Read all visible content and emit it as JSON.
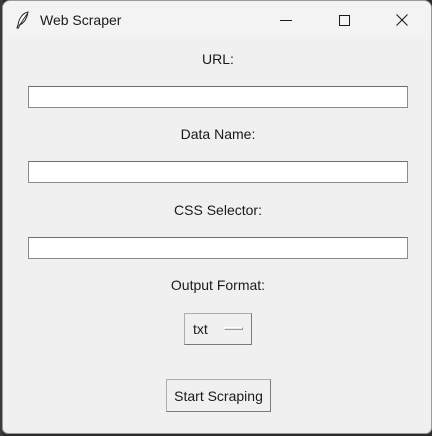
{
  "window": {
    "title": "Web Scraper",
    "icons": {
      "app": "feather-icon",
      "minimize": "minimize-icon",
      "maximize": "maximize-icon",
      "close": "close-icon"
    }
  },
  "form": {
    "url_label": "URL:",
    "url_value": "",
    "data_name_label": "Data Name:",
    "data_name_value": "",
    "css_selector_label": "CSS Selector:",
    "css_selector_value": "",
    "output_format_label": "Output Format:",
    "output_format_selected": "txt",
    "start_button_label": "Start Scraping"
  }
}
